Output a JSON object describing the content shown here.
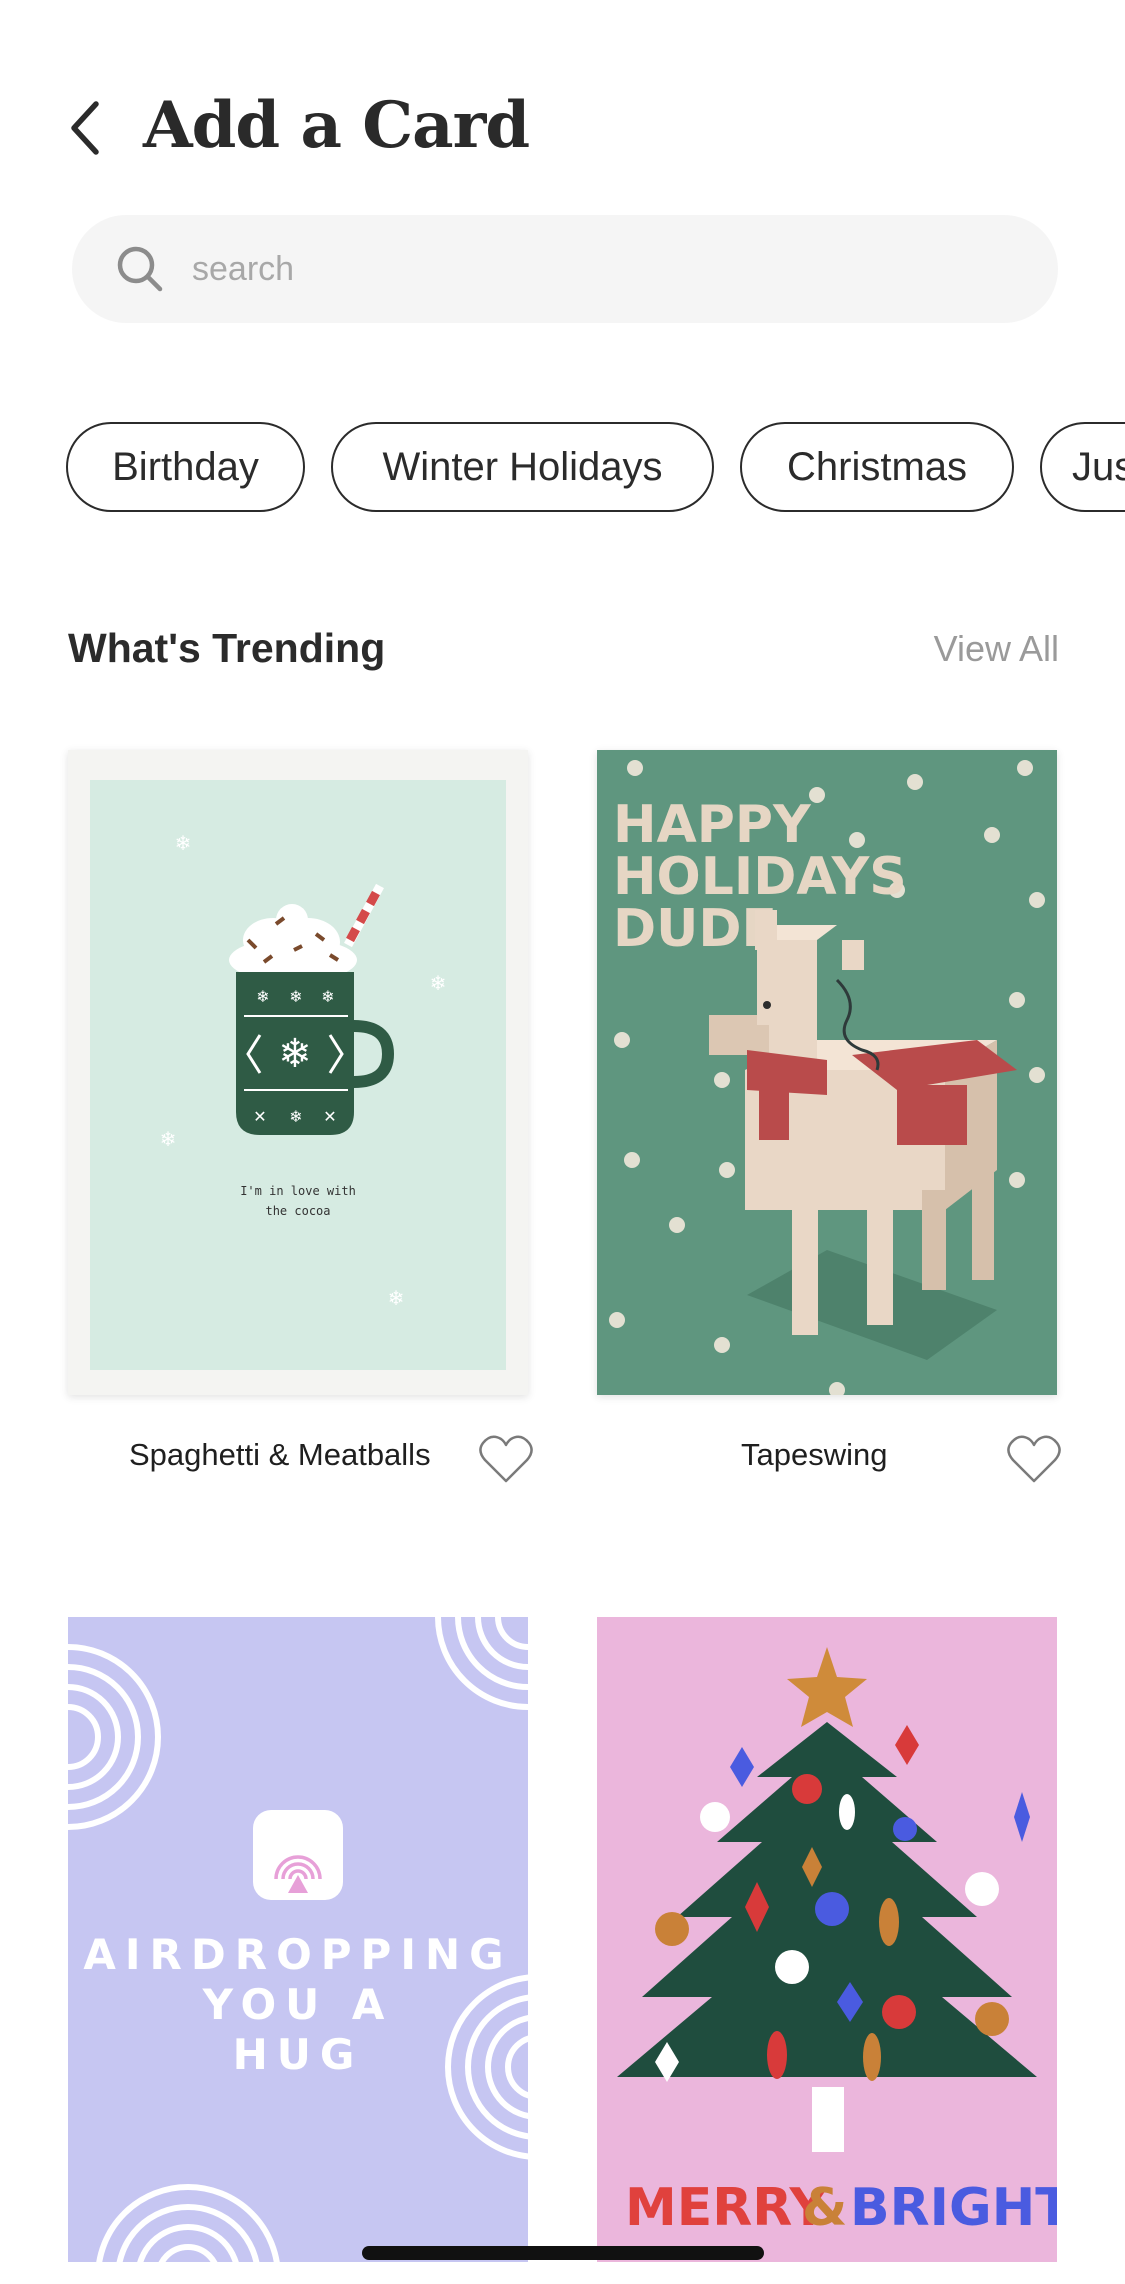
{
  "header": {
    "title": "Add a Card"
  },
  "search": {
    "placeholder": "search",
    "value": ""
  },
  "categories": [
    "Birthday",
    "Winter Holidays",
    "Christmas",
    "Jus"
  ],
  "section": {
    "title": "What's Trending",
    "view_all": "View All"
  },
  "cards": [
    {
      "name": "Spaghetti & Meatballs",
      "art_text": [
        "I'm in love with",
        "the cocoa"
      ],
      "favorited": false
    },
    {
      "name": "Tapeswing",
      "art_text": [
        "HAPPY",
        "HOLIDAYS",
        "DUDE"
      ],
      "favorited": false
    },
    {
      "art_text": [
        "AIRDROPPING",
        "YOU A",
        "HUG"
      ]
    },
    {
      "art_text": [
        "MERRY",
        "&",
        "BRIGHT"
      ]
    }
  ],
  "icons": {
    "back": "chevron-left-icon",
    "search": "search-icon",
    "favorite": "heart-outline-icon"
  },
  "colors": {
    "text": "#2b2b2b",
    "muted": "#9a9a9a",
    "search_bg": "#f5f5f5",
    "card1_bg": "#d6ebe2",
    "card2_bg": "#5f967f",
    "card3_bg": "#c6c6f2",
    "card4_bg": "#ebb6dc"
  }
}
